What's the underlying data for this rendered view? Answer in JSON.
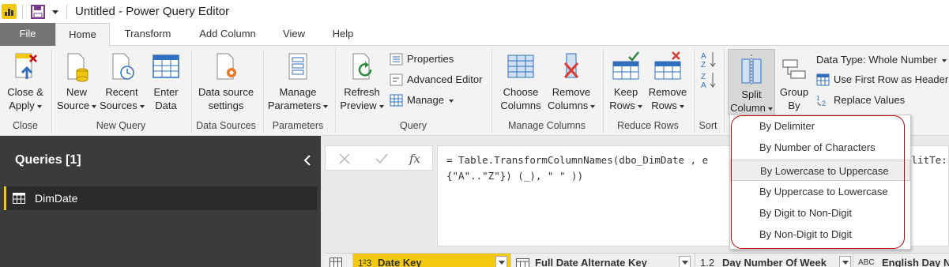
{
  "window": {
    "title": "Untitled - Power Query Editor"
  },
  "tabs": [
    {
      "label": "File"
    },
    {
      "label": "Home"
    },
    {
      "label": "Transform"
    },
    {
      "label": "Add Column"
    },
    {
      "label": "View"
    },
    {
      "label": "Help"
    }
  ],
  "ribbon": {
    "close": {
      "close_apply": "Close &",
      "close_apply2": "Apply",
      "group": "Close"
    },
    "new_query": {
      "new_source": "New",
      "new_source2": "Source",
      "recent_sources": "Recent",
      "recent_sources2": "Sources",
      "enter_data": "Enter",
      "enter_data2": "Data",
      "group": "New Query"
    },
    "data_sources": {
      "settings": "Data source",
      "settings2": "settings",
      "group": "Data Sources"
    },
    "parameters": {
      "manage": "Manage",
      "manage2": "Parameters",
      "group": "Parameters"
    },
    "query": {
      "refresh": "Refresh",
      "refresh2": "Preview",
      "properties": "Properties",
      "advanced_editor": "Advanced Editor",
      "manage": "Manage",
      "group": "Query"
    },
    "manage_columns": {
      "choose": "Choose",
      "choose2": "Columns",
      "remove": "Remove",
      "remove2": "Columns",
      "group": "Manage Columns"
    },
    "reduce_rows": {
      "keep": "Keep",
      "keep2": "Rows",
      "remove": "Remove",
      "remove2": "Rows",
      "group": "Reduce Rows"
    },
    "sort": {
      "group": "Sort"
    },
    "transform": {
      "split": "Split",
      "split2": "Column",
      "group_by": "Group",
      "group_by2": "By",
      "data_type": "Data Type: Whole Number",
      "first_row": "Use First Row as Headers",
      "replace": "Replace Values"
    }
  },
  "split_menu": {
    "items": [
      {
        "label": "By Delimiter"
      },
      {
        "label": "By Number of Characters"
      },
      {
        "label": "By Lowercase to Uppercase"
      },
      {
        "label": "By Uppercase to Lowercase"
      },
      {
        "label": "By Digit to Non-Digit"
      },
      {
        "label": "By Non-Digit to Digit"
      }
    ],
    "hover_index": 2
  },
  "queries": {
    "title": "Queries [1]",
    "items": [
      {
        "label": "DimDate"
      }
    ]
  },
  "formula": {
    "line1": "= Table.TransformColumnNames(dbo_DimDate , e",
    "line1_tail": "plitTe:",
    "line2": "{\"A\"..\"Z\"}) (_), \" \" ))"
  },
  "columns": [
    {
      "type": "1²3",
      "name": "Date Key"
    },
    {
      "type": "",
      "name": "Full Date Alternate Key"
    },
    {
      "type": "1.2",
      "name": "Day Number Of Week"
    },
    {
      "type": "ABC",
      "name": "English Day N"
    }
  ],
  "colors": {
    "accent": "#f2c811",
    "file_tab": "#737373",
    "highlight_outline": "#c8000a"
  }
}
